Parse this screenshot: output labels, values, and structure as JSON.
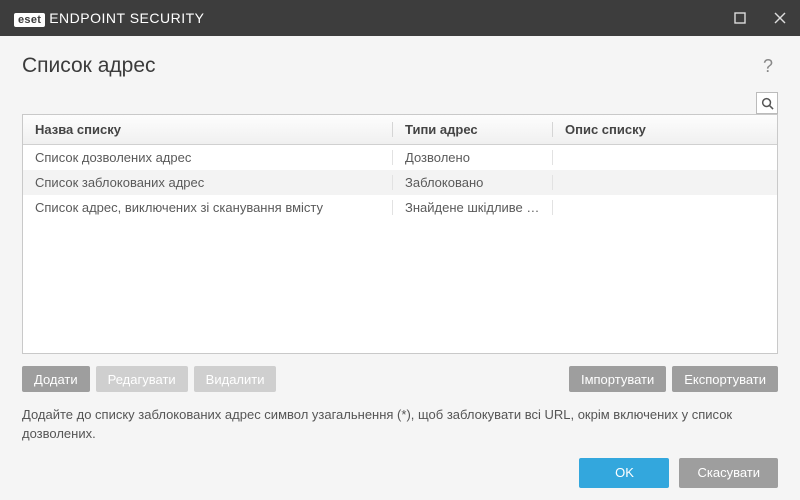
{
  "titlebar": {
    "brand_box": "eset",
    "product": "ENDPOINT SECURITY"
  },
  "heading": "Список адрес",
  "table": {
    "headers": {
      "name": "Назва списку",
      "type": "Типи адрес",
      "desc": "Опис списку"
    },
    "rows": [
      {
        "name": "Список дозволених адрес",
        "type": "Дозволено",
        "desc": ""
      },
      {
        "name": "Список заблокованих адрес",
        "type": "Заблоковано",
        "desc": ""
      },
      {
        "name": "Список адрес, виключених зі сканування вмісту",
        "type": "Знайдене шкідливе прог...",
        "desc": ""
      }
    ]
  },
  "toolbar": {
    "add": "Додати",
    "edit": "Редагувати",
    "delete": "Видалити",
    "import": "Імпортувати",
    "export": "Експортувати"
  },
  "hint": "Додайте до списку заблокованих адрес символ узагальнення (*), щоб заблокувати всі URL, окрім включених у список дозволених.",
  "footer": {
    "ok": "OK",
    "cancel": "Скасувати"
  }
}
